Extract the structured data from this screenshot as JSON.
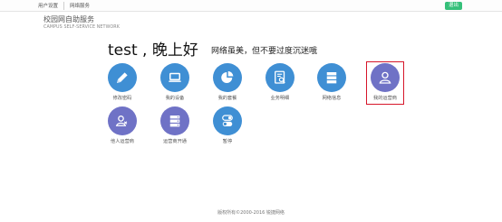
{
  "topbar": {
    "nav": [
      "用户设置",
      "网络服务"
    ],
    "logout_label": "退出"
  },
  "brand": {
    "title": "校园网自助服务",
    "subtitle": "CAMPUS SELF-SERVICE NETWORK"
  },
  "greeting": "test , 晚上好",
  "slogan": "网络虽美，但不要过度沉迷哦",
  "tiles": [
    {
      "label": "修改密码",
      "icon": "pencil-icon"
    },
    {
      "label": "我的设备",
      "icon": "laptop-icon"
    },
    {
      "label": "我的套餐",
      "icon": "pie-chart-icon"
    },
    {
      "label": "业务明细",
      "icon": "document-search-icon"
    },
    {
      "label": "网络信息",
      "icon": "server-icon"
    },
    {
      "label": "我的运营商",
      "icon": "user-icon"
    },
    {
      "label": "他人运营商",
      "icon": "users-icon"
    },
    {
      "label": "运营商开通",
      "icon": "server-stack-icon"
    },
    {
      "label": "暂停",
      "icon": "toggle-icon"
    }
  ],
  "colors": {
    "blue_tile": "#3f8fd4",
    "purple_tile": "#6f72c6",
    "logout_green": "#36c07a",
    "selection_red": "#d6162a"
  },
  "footer": "版权所有©2000-2016 锐捷网络"
}
